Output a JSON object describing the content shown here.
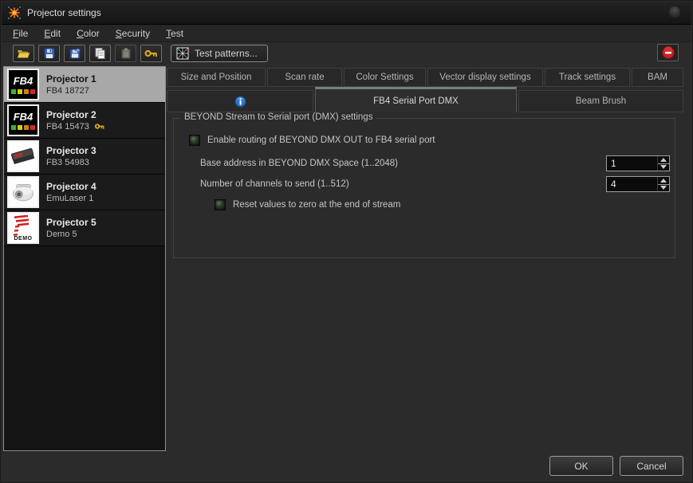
{
  "window": {
    "title": "Projector settings"
  },
  "menu": {
    "items": [
      "File",
      "Edit",
      "Color",
      "Security",
      "Test"
    ]
  },
  "toolbar": {
    "test_patterns_label": "Test patterns..."
  },
  "sidebar": {
    "projectors": [
      {
        "name": "Projector 1",
        "model": "FB4 18727"
      },
      {
        "name": "Projector 2",
        "model": "FB4 15473"
      },
      {
        "name": "Projector 3",
        "model": "FB3 54983"
      },
      {
        "name": "Projector 4",
        "model": "EmuLaser 1"
      },
      {
        "name": "Projector 5",
        "model": "Demo 5"
      }
    ],
    "fb4_logo": "FB4",
    "demo_label": "DEMO"
  },
  "tabs": {
    "row1": [
      "Size and Position",
      "Scan rate",
      "Color Settings",
      "Vector display settings",
      "Track settings",
      "BAM"
    ],
    "row2": {
      "info": "",
      "fb4_dmx": "FB4 Serial Port DMX",
      "beam_brush": "Beam Brush"
    },
    "selected": "FB4 Serial Port DMX"
  },
  "panel": {
    "group_title": "BEYOND Stream to Serial port (DMX) settings",
    "enable_label": "Enable routing of BEYOND DMX OUT to FB4 serial port",
    "enable_checked": true,
    "base_address_label": "Base address in BEYOND DMX Space (1..2048)",
    "base_address_value": "1",
    "channels_label": "Number of channels to send (1..512)",
    "channels_value": "4",
    "reset_label": "Reset values to zero at the end of stream",
    "reset_checked": true
  },
  "footer": {
    "ok_label": "OK",
    "cancel_label": "Cancel"
  },
  "colors": {
    "accent_tab_highlight": "#6f827b",
    "selected_item_bg": "#a8a8a8",
    "checkbox_green": "#5f6f55",
    "remove_red": "#cc2222",
    "key_gold": "#d9a81c"
  }
}
